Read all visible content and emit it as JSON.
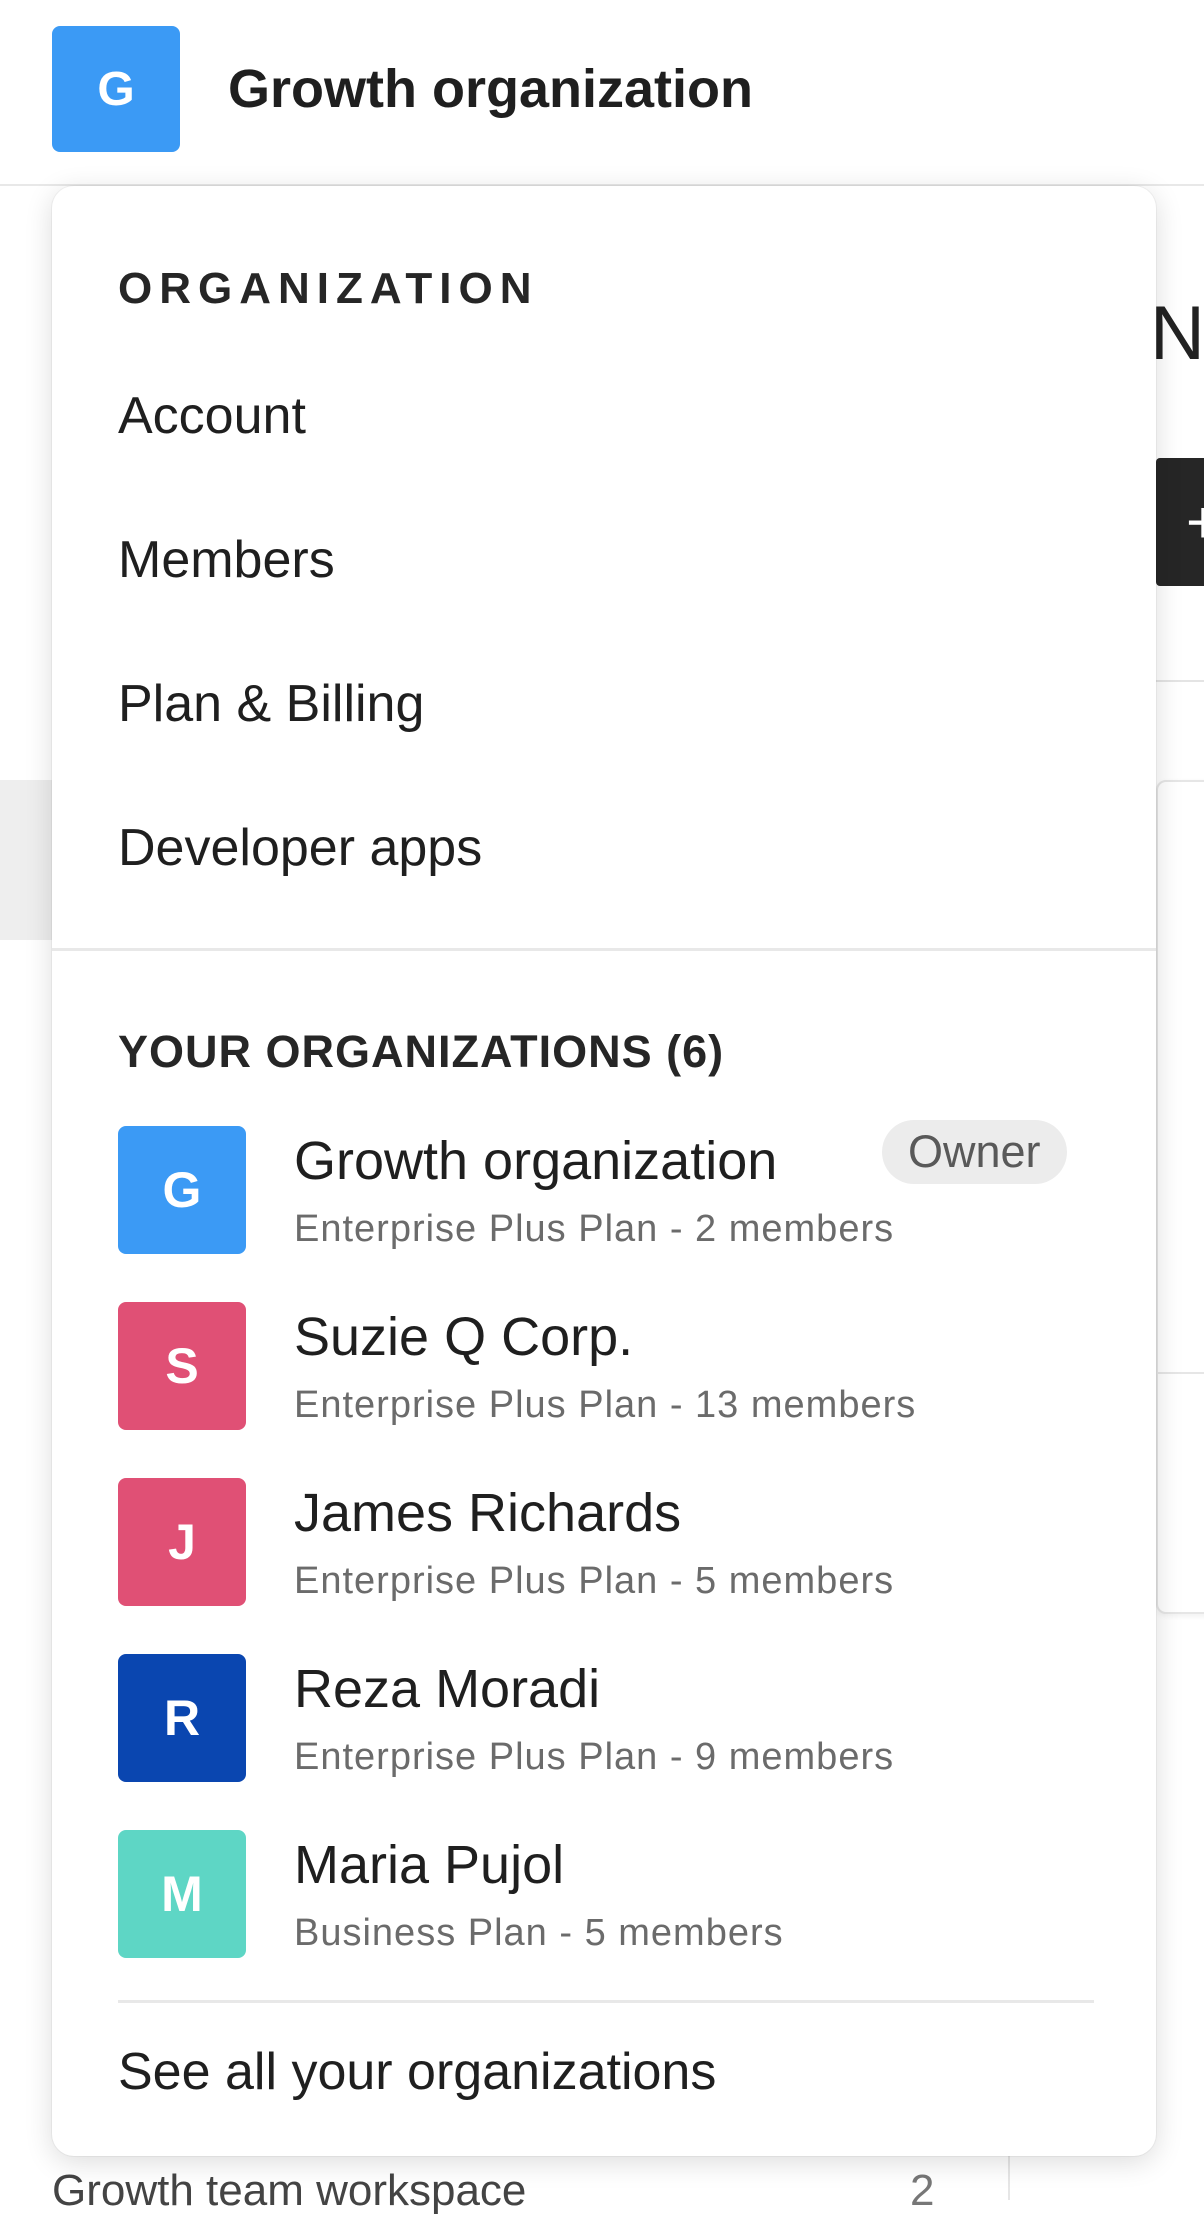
{
  "header": {
    "org_initial": "G",
    "org_name": "Growth organization"
  },
  "background": {
    "heading_fragment": "Ne",
    "button_fragment": "+",
    "workspace_label": "Growth team workspace",
    "workspace_count": "2"
  },
  "menu": {
    "section_title": "ORGANIZATION",
    "items": [
      {
        "label": "Account"
      },
      {
        "label": "Members"
      },
      {
        "label": "Plan & Billing"
      },
      {
        "label": "Developer apps"
      }
    ]
  },
  "organizations": {
    "section_title": "YOUR ORGANIZATIONS (6)",
    "list": [
      {
        "initial": "G",
        "name": "Growth organization",
        "badge": "Owner",
        "details": "Enterprise Plus Plan - 2 members",
        "color": "#3b9af5"
      },
      {
        "initial": "S",
        "name": "Suzie Q Corp.",
        "badge": "",
        "details": "Enterprise Plus Plan - 13 members",
        "color": "#e05075"
      },
      {
        "initial": "J",
        "name": "James Richards",
        "badge": "",
        "details": "Enterprise Plus Plan - 5 members",
        "color": "#e05075"
      },
      {
        "initial": "R",
        "name": "Reza Moradi",
        "badge": "",
        "details": "Enterprise Plus Plan - 9 members",
        "color": "#0a46b0"
      },
      {
        "initial": "M",
        "name": "Maria Pujol",
        "badge": "",
        "details": "Business Plan - 5 members",
        "color": "#5ed6c5"
      }
    ],
    "see_all_label": "See all your organizations"
  },
  "colors": {
    "header_avatar": "#3b9af5",
    "badge_background": "#ececec"
  }
}
